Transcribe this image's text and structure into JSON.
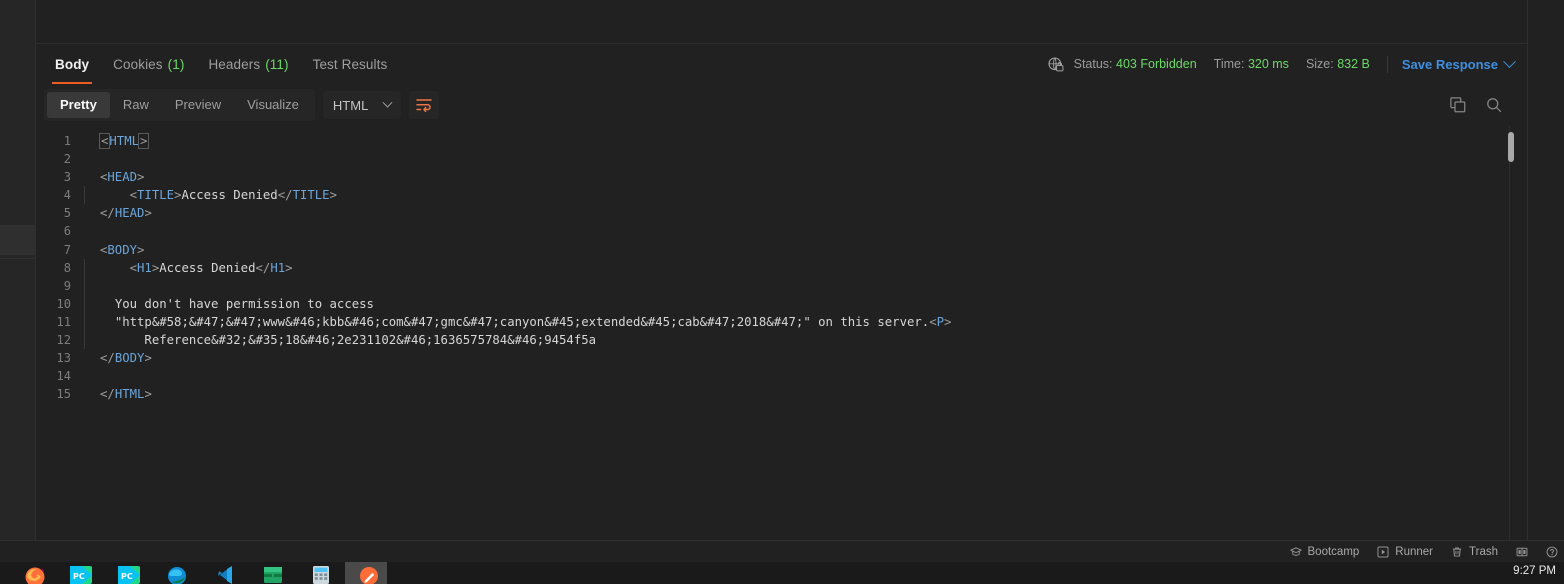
{
  "response": {
    "tabs": [
      {
        "label": "Body",
        "count": "",
        "active": true
      },
      {
        "label": "Cookies",
        "count": "(1)",
        "active": false
      },
      {
        "label": "Headers",
        "count": "(11)",
        "active": false
      },
      {
        "label": "Test Results",
        "count": "",
        "active": false
      }
    ],
    "meta": {
      "secure_icon": "globe-lock-icon",
      "status_label": "Status:",
      "status_value": "403 Forbidden",
      "time_label": "Time:",
      "time_value": "320 ms",
      "size_label": "Size:",
      "size_value": "832 B",
      "save_response": "Save Response"
    },
    "viewmodes": [
      {
        "label": "Pretty",
        "active": true
      },
      {
        "label": "Raw",
        "active": false
      },
      {
        "label": "Preview",
        "active": false
      },
      {
        "label": "Visualize",
        "active": false
      }
    ],
    "language": "HTML",
    "wrap_button": "wrap-lines-icon",
    "copy_button": "copy-icon",
    "search_button": "search-icon"
  },
  "code": {
    "lines": [
      {
        "n": "1",
        "indent": false,
        "html": "<span class=\"br bk-hl\">&lt;</span><span class=\"tg\">HTML</span><span class=\"br bk-hl\">&gt;</span>"
      },
      {
        "n": "2",
        "indent": false,
        "html": ""
      },
      {
        "n": "3",
        "indent": false,
        "html": "<span class=\"br\">&lt;</span><span class=\"tg\">HEAD</span><span class=\"br\">&gt;</span>"
      },
      {
        "n": "4",
        "indent": true,
        "html": "    <span class=\"br\">&lt;</span><span class=\"tg\">TITLE</span><span class=\"br\">&gt;</span><span class=\"ent\">Access Denied</span><span class=\"br\">&lt;/</span><span class=\"tg\">TITLE</span><span class=\"br\">&gt;</span>"
      },
      {
        "n": "5",
        "indent": false,
        "html": "<span class=\"br\">&lt;/</span><span class=\"tg\">HEAD</span><span class=\"br\">&gt;</span>"
      },
      {
        "n": "6",
        "indent": false,
        "html": ""
      },
      {
        "n": "7",
        "indent": false,
        "html": "<span class=\"br\">&lt;</span><span class=\"tg\">BODY</span><span class=\"br\">&gt;</span>"
      },
      {
        "n": "8",
        "indent": true,
        "html": "    <span class=\"br\">&lt;</span><span class=\"tg\">H1</span><span class=\"br\">&gt;</span><span class=\"ent\">Access Denied</span><span class=\"br\">&lt;/</span><span class=\"tg\">H1</span><span class=\"br\">&gt;</span>"
      },
      {
        "n": "9",
        "indent": true,
        "html": ""
      },
      {
        "n": "10",
        "indent": true,
        "html": "  <span class=\"ent\">You don't have permission to access</span>"
      },
      {
        "n": "11",
        "indent": true,
        "html": "  <span class=\"ent\">\"http&amp;#58;&amp;#47;&amp;#47;www&amp;#46;kbb&amp;#46;com&amp;#47;gmc&amp;#47;canyon&amp;#45;extended&amp;#45;cab&amp;#47;2018&amp;#47;\" on this server.</span><span class=\"br\">&lt;</span><span class=\"tg\">P</span><span class=\"br\">&gt;</span>"
      },
      {
        "n": "12",
        "indent": true,
        "html": "      <span class=\"ent\">Reference&amp;#32;&amp;#35;18&amp;#46;2e231102&amp;#46;1636575784&amp;#46;9454f5a</span>"
      },
      {
        "n": "13",
        "indent": false,
        "html": "<span class=\"br\">&lt;/</span><span class=\"tg\">BODY</span><span class=\"br\">&gt;</span>"
      },
      {
        "n": "14",
        "indent": false,
        "html": ""
      },
      {
        "n": "15",
        "indent": false,
        "html": "<span class=\"br\">&lt;/</span><span class=\"tg\">HTML</span><span class=\"br\">&gt;</span>"
      }
    ]
  },
  "bottom_bar": {
    "items": [
      {
        "label": "Bootcamp",
        "icon": "graduation-cap-icon"
      },
      {
        "label": "Runner",
        "icon": "play-box-icon"
      },
      {
        "label": "Trash",
        "icon": "trash-icon"
      }
    ],
    "layout_icon": "two-pane-layout-icon",
    "help_icon": "help-circle-icon"
  },
  "dock": {
    "clock": "9:27 PM",
    "apps": [
      {
        "name": "firefox-icon"
      },
      {
        "name": "pycharm-icon"
      },
      {
        "name": "pycharm-pro-icon"
      },
      {
        "name": "edge-icon"
      },
      {
        "name": "vscode-icon"
      },
      {
        "name": "excel-icon"
      },
      {
        "name": "calculator-icon"
      },
      {
        "name": "postman-icon"
      }
    ]
  },
  "colors": {
    "accent": "#ef5b25",
    "status_green": "#6bd968",
    "link_blue": "#3f8fe0",
    "tag_blue": "#6ba5d9",
    "bg": "#212121"
  }
}
